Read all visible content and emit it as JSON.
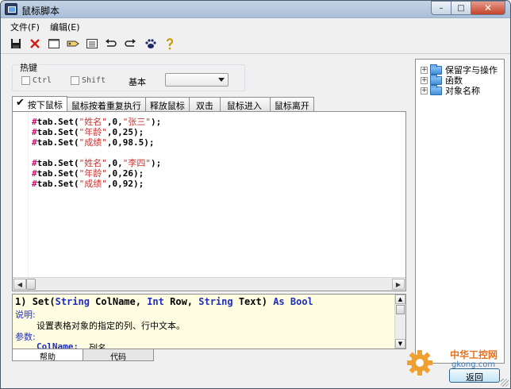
{
  "window": {
    "title": "鼠标脚本"
  },
  "caption": {
    "minimize": "–",
    "maximize": "□",
    "close": "✕"
  },
  "menu": {
    "file": "文件(F)",
    "edit": "编辑(E)"
  },
  "toolbar": {
    "icons": [
      "save-icon",
      "delete-icon",
      "new-icon",
      "tag-icon",
      "list-icon",
      "undo-icon",
      "redo-icon",
      "paw-icon",
      "help-icon"
    ]
  },
  "hotkey": {
    "legend": "热键",
    "ctrl_label": "Ctrl",
    "shift_label": "Shift",
    "basic_label": "基本",
    "basic_value": ""
  },
  "tabs": [
    {
      "label": "按下鼠标"
    },
    {
      "label": "鼠标按着重复执行"
    },
    {
      "label": "释放鼠标"
    },
    {
      "label": "双击"
    },
    {
      "label": "鼠标进入"
    },
    {
      "label": "鼠标离开"
    }
  ],
  "editor": {
    "lines": [
      {
        "prefix": "#",
        "obj": "tab",
        "method": ".Set(",
        "arg1": "\"姓名\"",
        "rest": ",0,",
        "arg2": "\"张三\"",
        "end": ");"
      },
      {
        "prefix": "#",
        "obj": "tab",
        "method": ".Set(",
        "arg1": "\"年龄\"",
        "rest": ",0,25",
        "arg2": "",
        "end": ");"
      },
      {
        "prefix": "#",
        "obj": "tab",
        "method": ".Set(",
        "arg1": "\"成绩\"",
        "rest": ",0,98.5",
        "arg2": "",
        "end": ");"
      },
      {
        "prefix": "",
        "obj": "",
        "method": "",
        "arg1": "",
        "rest": "",
        "arg2": "",
        "end": ""
      },
      {
        "prefix": "#",
        "obj": "tab",
        "method": ".Set(",
        "arg1": "\"姓名\"",
        "rest": ",0,",
        "arg2": "\"李四\"",
        "end": ");"
      },
      {
        "prefix": "#",
        "obj": "tab",
        "method": ".Set(",
        "arg1": "\"年龄\"",
        "rest": ",0,26",
        "arg2": "",
        "end": ");"
      },
      {
        "prefix": "#",
        "obj": "tab",
        "method": ".Set(",
        "arg1": "\"成绩\"",
        "rest": ",0,92",
        "arg2": "",
        "end": ");"
      }
    ]
  },
  "help": {
    "sig_num": "1) ",
    "sig_fn": "Set(",
    "sig_t1": "String",
    "sig_p1": " ColName, ",
    "sig_t2": "Int",
    "sig_p2": " Row, ",
    "sig_t3": "String",
    "sig_p3": " Text) ",
    "sig_as": "As",
    "sig_sp": " ",
    "sig_ret": "Bool",
    "desc_label": "说明:",
    "desc_text": "设置表格对象的指定的列、行中文本。",
    "params_label": "参数:",
    "param_name": "ColName:",
    "param_desc": "列名"
  },
  "bottom_tabs": {
    "help": "帮助",
    "code": "代码"
  },
  "tree": {
    "items": [
      {
        "label": "保留字与操作"
      },
      {
        "label": "函数"
      },
      {
        "label": "对象名称"
      }
    ]
  },
  "status": {
    "return_label": "返回"
  },
  "watermark": {
    "cn": "中华工控网",
    "en": "gkong.com"
  }
}
